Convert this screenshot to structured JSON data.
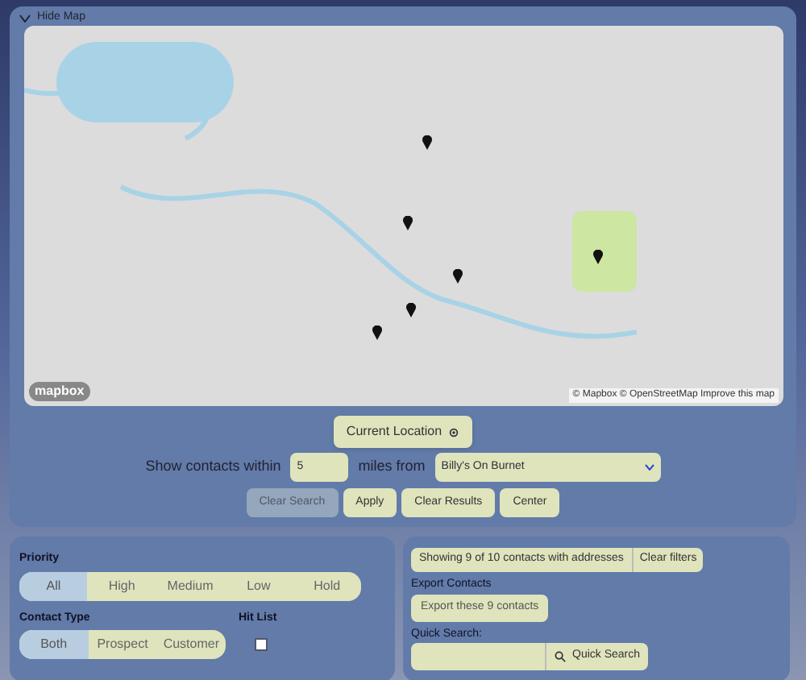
{
  "map_panel": {
    "toggle_label": "Hide Map",
    "expanded": true,
    "attribution_logo": "mapbox",
    "attribution": "© Mapbox © OpenStreetMap Improve this map"
  },
  "search": {
    "current_location": "Current Location",
    "prefix": "Show contacts within",
    "distance": "5",
    "middle": "miles from",
    "from_value": "Billy's On Burnet",
    "buttons": [
      {
        "label": "Clear Search",
        "disabled": true
      },
      {
        "label": "Apply",
        "disabled": false
      },
      {
        "label": "Clear Results",
        "disabled": false
      },
      {
        "label": "Center",
        "disabled": false
      }
    ]
  },
  "priority": {
    "label": "Priority",
    "options": [
      {
        "label": "All",
        "selected": true
      },
      {
        "label": "High",
        "selected": false
      },
      {
        "label": "Medium",
        "selected": false
      },
      {
        "label": "Low",
        "selected": false
      },
      {
        "label": "Hold",
        "selected": false
      }
    ]
  },
  "contact_type": {
    "label": "Contact Type",
    "options": [
      {
        "label": "Both",
        "selected": true
      },
      {
        "label": "Prospect",
        "selected": false
      },
      {
        "label": "Customer",
        "selected": false
      }
    ]
  },
  "hit_list": {
    "label": "Hit List",
    "checked": false
  },
  "summary": {
    "showing": "Showing 9 of 10 contacts with addresses",
    "clear_filters": "Clear filters"
  },
  "export": {
    "label": "Export Contacts",
    "button": "Export these 9 contacts"
  },
  "quick_search": {
    "label": "Quick Search:",
    "button": "Quick Search"
  }
}
